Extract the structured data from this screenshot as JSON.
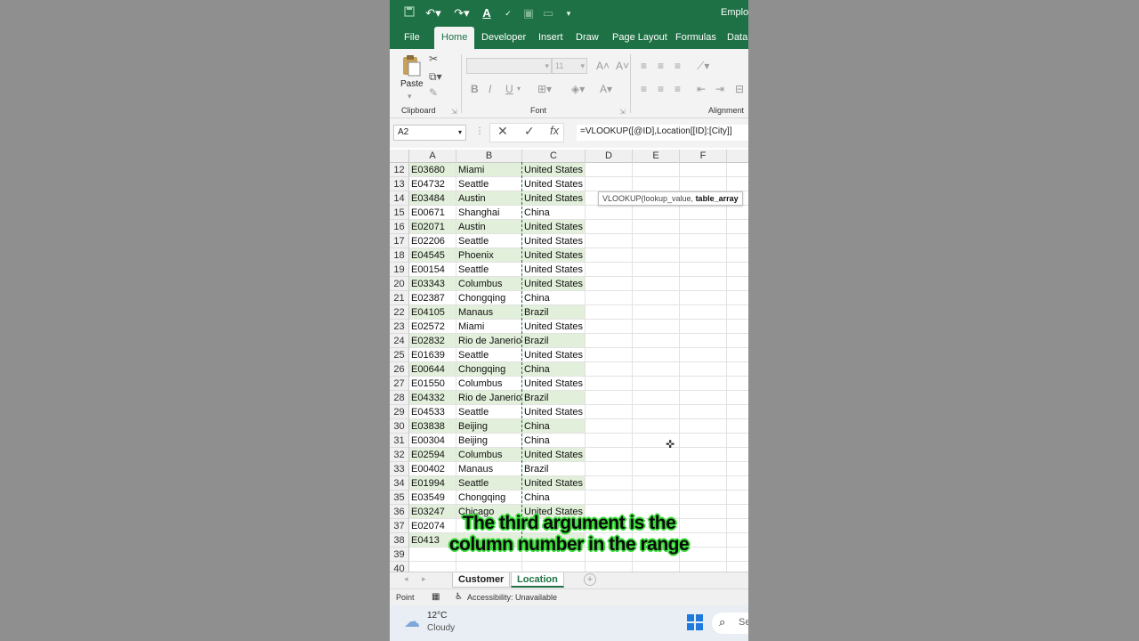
{
  "window": {
    "title": "Employ"
  },
  "tabs": [
    "File",
    "Home",
    "Developer",
    "Insert",
    "Draw",
    "Page Layout",
    "Formulas",
    "Data"
  ],
  "active_tab": "Home",
  "ribbon": {
    "clipboard_label": "Clipboard",
    "paste_label": "Paste",
    "font_label": "Font",
    "alignment_label": "Alignment",
    "font_size": "11"
  },
  "formula_bar": {
    "name_box": "A2",
    "formula": "=VLOOKUP([@ID],Location[[ID]:[City]]"
  },
  "grid": {
    "columns": [
      "A",
      "B",
      "C",
      "D",
      "E",
      "F"
    ],
    "rows": [
      {
        "n": "12",
        "id": "E03680",
        "city": "Miami",
        "country": "United States"
      },
      {
        "n": "13",
        "id": "E04732",
        "city": "Seattle",
        "country": "United States"
      },
      {
        "n": "14",
        "id": "E03484",
        "city": "Austin",
        "country": "United States"
      },
      {
        "n": "15",
        "id": "E00671",
        "city": "Shanghai",
        "country": "China"
      },
      {
        "n": "16",
        "id": "E02071",
        "city": "Austin",
        "country": "United States"
      },
      {
        "n": "17",
        "id": "E02206",
        "city": "Seattle",
        "country": "United States"
      },
      {
        "n": "18",
        "id": "E04545",
        "city": "Phoenix",
        "country": "United States"
      },
      {
        "n": "19",
        "id": "E00154",
        "city": "Seattle",
        "country": "United States"
      },
      {
        "n": "20",
        "id": "E03343",
        "city": "Columbus",
        "country": "United States"
      },
      {
        "n": "21",
        "id": "E02387",
        "city": "Chongqing",
        "country": "China"
      },
      {
        "n": "22",
        "id": "E04105",
        "city": "Manaus",
        "country": "Brazil"
      },
      {
        "n": "23",
        "id": "E02572",
        "city": "Miami",
        "country": "United States"
      },
      {
        "n": "24",
        "id": "E02832",
        "city": "Rio de Janerio",
        "country": "Brazil"
      },
      {
        "n": "25",
        "id": "E01639",
        "city": "Seattle",
        "country": "United States"
      },
      {
        "n": "26",
        "id": "E00644",
        "city": "Chongqing",
        "country": "China"
      },
      {
        "n": "27",
        "id": "E01550",
        "city": "Columbus",
        "country": "United States"
      },
      {
        "n": "28",
        "id": "E04332",
        "city": "Rio de Janerio",
        "country": "Brazil"
      },
      {
        "n": "29",
        "id": "E04533",
        "city": "Seattle",
        "country": "United States"
      },
      {
        "n": "30",
        "id": "E03838",
        "city": "Beijing",
        "country": "China"
      },
      {
        "n": "31",
        "id": "E00304",
        "city": "Beijing",
        "country": "China"
      },
      {
        "n": "32",
        "id": "E02594",
        "city": "Columbus",
        "country": "United States"
      },
      {
        "n": "33",
        "id": "E00402",
        "city": "Manaus",
        "country": "Brazil"
      },
      {
        "n": "34",
        "id": "E01994",
        "city": "Seattle",
        "country": "United States"
      },
      {
        "n": "35",
        "id": "E03549",
        "city": "Chongqing",
        "country": "China"
      },
      {
        "n": "36",
        "id": "E03247",
        "city": "Chicago",
        "country": "United States"
      },
      {
        "n": "37",
        "id": "E02074",
        "city": "",
        "country": ""
      },
      {
        "n": "38",
        "id": "E0413",
        "city": "",
        "country": ""
      },
      {
        "n": "39",
        "id": "",
        "city": "",
        "country": ""
      },
      {
        "n": "40",
        "id": "",
        "city": "",
        "country": ""
      }
    ]
  },
  "tooltip": {
    "fn": "VLOOKUP(lookup_value, ",
    "arg": "table_array"
  },
  "caption": {
    "line1": "The third argument is the",
    "line2": "column number in the range"
  },
  "sheets": [
    "Customer",
    "Location"
  ],
  "active_sheet": "Location",
  "status": {
    "mode": "Point",
    "accessibility": "Accessibility: Unavailable"
  },
  "taskbar": {
    "temp": "12°C",
    "weather": "Cloudy",
    "search": "Se"
  },
  "colors": {
    "excel_green": "#1e7145",
    "band": "#e2efda"
  }
}
